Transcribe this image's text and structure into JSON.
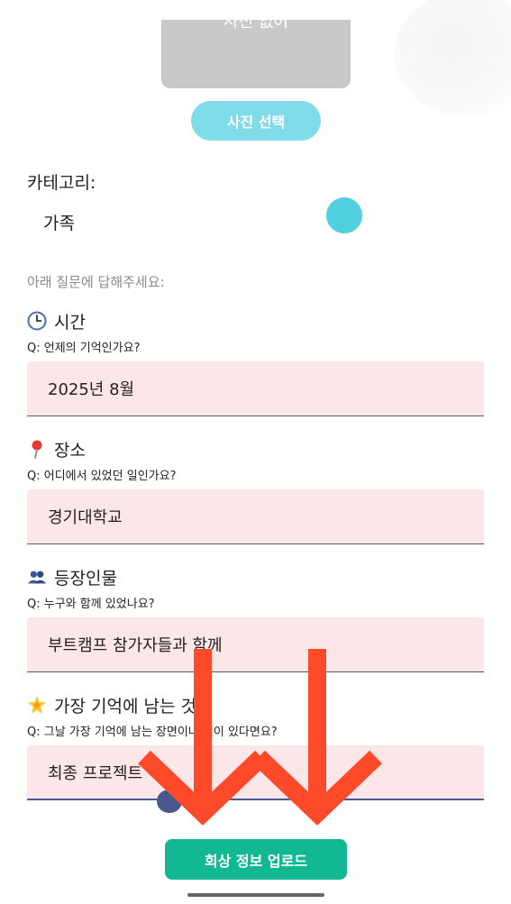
{
  "photo": {
    "caption": "사진 없어",
    "select_button": "사진 선택"
  },
  "category": {
    "label": "카테고리:",
    "value": "가족"
  },
  "instruction": "아래 질문에 답해주세요:",
  "questions": [
    {
      "icon": "clock-icon",
      "title": "시간",
      "question": "Q: 언제의 기억인가요?",
      "answer": "2025년 8월"
    },
    {
      "icon": "pin-icon",
      "title": "장소",
      "question": "Q: 어디에서 있었던 일인가요?",
      "answer": "경기대학교"
    },
    {
      "icon": "people-icon",
      "title": "등장인물",
      "question": "Q: 누구와 함께 있었나요?",
      "answer": "부트캠프 참가자들과 함께"
    },
    {
      "icon": "star-icon",
      "title": "가장 기억에 남는 것",
      "question": "Q: 그날 가장 기억에 남는 장면이나 일이 있다면요?",
      "answer": "최종 프로젝트"
    }
  ],
  "upload_button": "회상 정보 업로드",
  "colors": {
    "select_button": "#7fdbe7",
    "category_dot": "#4fcfe0",
    "field_bg": "#fde6e8",
    "upload_button": "#12b894",
    "arrow": "#ff4a2a"
  }
}
